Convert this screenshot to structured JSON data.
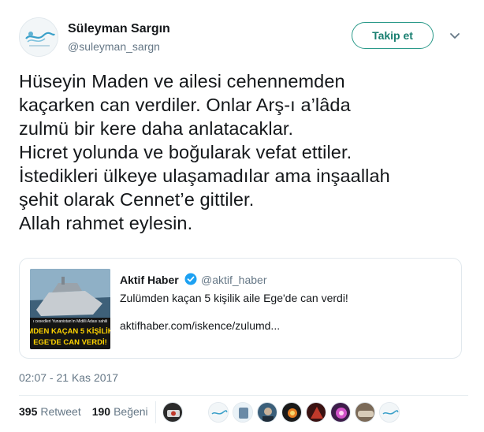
{
  "tweet": {
    "author_name": "Süleyman Sargın",
    "author_handle": "@suleyman_sargn",
    "follow_label": "Takip et",
    "text": "Hüseyin Maden ve ailesi cehennemden\nkaçarken can verdiler. Onlar Arş-ı a’lâda\nzulmü bir kere daha anlatacaklar.\nHicret yolunda ve boğularak vefat ettiler.\nİstedikleri ülkeye ulaşamadılar ama inşaallah\nşehit olarak Cennet’e gittiler.\nAllah rahmet eylesin.",
    "timestamp": "02:07 - 21 Kas 2017",
    "retweets": {
      "count": "395",
      "label": "Retweet"
    },
    "likes": {
      "count": "190",
      "label": "Beğeni"
    }
  },
  "card": {
    "name": "Aktif Haber",
    "handle": "@aktif_haber",
    "description": "Zulümden kaçan 5 kişilik aile Ege'de can verdi!",
    "link": "aktifhaber.com/iskence/zulumd...",
    "thumb_caption_line1": "MDEN KAÇAN 5 KİŞİLİK",
    "thumb_caption_line2": "EGE'DE CAN VERDİ!"
  },
  "icons": {
    "caret": "chevron-down-icon",
    "verified": "verified-badge-icon"
  },
  "colors": {
    "follow_accent": "#1a7f71",
    "verified_blue": "#1da1f2",
    "muted": "#657786",
    "thumb_caption": "#ffd400"
  }
}
